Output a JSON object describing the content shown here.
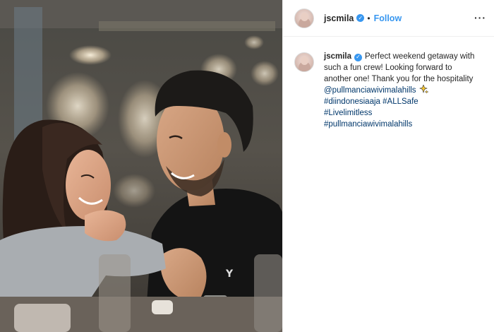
{
  "post": {
    "username": "jscmila",
    "verified_icon": "verified-badge-icon",
    "separator": "•",
    "follow_label": "Follow",
    "more_icon": "more-options-icon",
    "more_glyph": "···"
  },
  "caption": {
    "username": "jscmila",
    "body": "Perfect weekend getaway with such a fun crew! Looking forward to another one! Thank you for the hospitality",
    "mention": "@pullmanciawivimalahills",
    "emoji_icon": "sparkles-emoji-icon",
    "hashtags": [
      "#diindonesiaaja",
      "#ALLSafe",
      "#Livelimitless",
      "#pullmanciawivimalahills"
    ]
  },
  "colors": {
    "link": "#00376b",
    "follow": "#3897f0",
    "verified": "#3897f0",
    "text": "#262626"
  }
}
